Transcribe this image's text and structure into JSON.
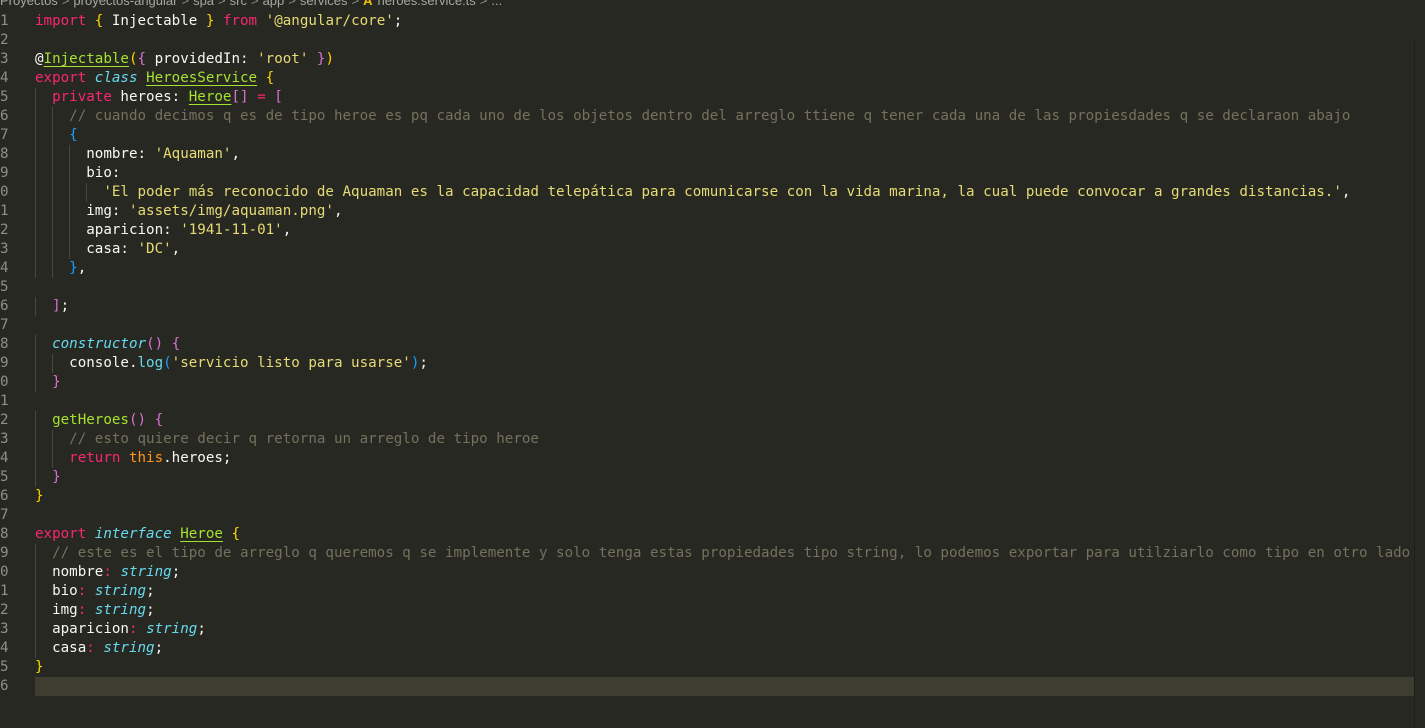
{
  "breadcrumb": [
    "Proyectos",
    "proyectos-angular",
    "spa",
    "src",
    "app",
    "services",
    "heroes.service.ts",
    "..."
  ],
  "colors": {
    "background": "#272822",
    "keyword": "#f92672",
    "string": "#e6db74",
    "comment": "#75715e",
    "class_name": "#a6e22e",
    "type": "#66d9ef",
    "current_line": "#3e3d32"
  },
  "file_icon": "angular-icon",
  "current_line": 36,
  "lines": [
    {
      "n": "1",
      "t": [
        [
          "k",
          "import"
        ],
        [
          "t",
          " "
        ],
        [
          "y",
          "{"
        ],
        [
          "t",
          " Injectable "
        ],
        [
          "y",
          "}"
        ],
        [
          "t",
          " "
        ],
        [
          "k",
          "from"
        ],
        [
          "t",
          " "
        ],
        [
          "s",
          "'@angular/core'"
        ],
        [
          "t",
          ";"
        ]
      ]
    },
    {
      "n": "2",
      "t": []
    },
    {
      "n": "3",
      "t": [
        [
          "t",
          "@"
        ],
        [
          "g",
          "Injectable"
        ],
        [
          "y",
          "("
        ],
        [
          "p",
          "{"
        ],
        [
          "t",
          " providedIn: "
        ],
        [
          "s",
          "'root'"
        ],
        [
          "t",
          " "
        ],
        [
          "p",
          "}"
        ],
        [
          "y",
          ")"
        ]
      ]
    },
    {
      "n": "4",
      "t": [
        [
          "k",
          "export"
        ],
        [
          "t",
          " "
        ],
        [
          "i",
          "class"
        ],
        [
          "t",
          " "
        ],
        [
          "g",
          "HeroesService"
        ],
        [
          "t",
          " "
        ],
        [
          "y",
          "{"
        ]
      ]
    },
    {
      "n": "5",
      "t": [
        [
          "t",
          "  "
        ],
        [
          "k",
          "private"
        ],
        [
          "t",
          " heroes: "
        ],
        [
          "g",
          "Heroe"
        ],
        [
          "p",
          "[]"
        ],
        [
          "t",
          " "
        ],
        [
          "r",
          "="
        ],
        [
          "t",
          " "
        ],
        [
          "p",
          "["
        ]
      ]
    },
    {
      "n": "6",
      "t": [
        [
          "t",
          "    "
        ],
        [
          "c",
          "// cuando decimos q es de tipo heroe es pq cada uno de los objetos dentro del arreglo ttiene q tener cada una de las propiesdades q se declaraon abajo"
        ]
      ]
    },
    {
      "n": "7",
      "t": [
        [
          "t",
          "    "
        ],
        [
          "b",
          "{"
        ]
      ]
    },
    {
      "n": "8",
      "t": [
        [
          "t",
          "      nombre: "
        ],
        [
          "s",
          "'Aquaman'"
        ],
        [
          "t",
          ","
        ]
      ]
    },
    {
      "n": "9",
      "t": [
        [
          "t",
          "      bio:"
        ]
      ]
    },
    {
      "n": "0",
      "t": [
        [
          "t",
          "        "
        ],
        [
          "s",
          "'El poder más reconocido de Aquaman es la capacidad telepática para comunicarse con la vida marina, la cual puede convocar a grandes distancias.'"
        ],
        [
          "t",
          ","
        ]
      ]
    },
    {
      "n": "1",
      "t": [
        [
          "t",
          "      img: "
        ],
        [
          "s",
          "'assets/img/aquaman.png'"
        ],
        [
          "t",
          ","
        ]
      ]
    },
    {
      "n": "2",
      "t": [
        [
          "t",
          "      aparicion: "
        ],
        [
          "s",
          "'1941-11-01'"
        ],
        [
          "t",
          ","
        ]
      ]
    },
    {
      "n": "3",
      "t": [
        [
          "t",
          "      casa: "
        ],
        [
          "s",
          "'DC'"
        ],
        [
          "t",
          ","
        ]
      ]
    },
    {
      "n": "4",
      "t": [
        [
          "t",
          "    "
        ],
        [
          "b",
          "}"
        ],
        [
          "t",
          ","
        ]
      ]
    },
    {
      "n": "5",
      "t": []
    },
    {
      "n": "6",
      "t": [
        [
          "t",
          "  "
        ],
        [
          "p",
          "]"
        ],
        [
          "t",
          ";"
        ]
      ]
    },
    {
      "n": "7",
      "t": []
    },
    {
      "n": "8",
      "t": [
        [
          "t",
          "  "
        ],
        [
          "i",
          "constructor"
        ],
        [
          "p",
          "()"
        ],
        [
          "t",
          " "
        ],
        [
          "p",
          "{"
        ]
      ]
    },
    {
      "n": "9",
      "t": [
        [
          "t",
          "    console."
        ],
        [
          "f",
          "log"
        ],
        [
          "b",
          "("
        ],
        [
          "s",
          "'servicio listo para usarse'"
        ],
        [
          "b",
          ")"
        ],
        [
          "t",
          ";"
        ]
      ]
    },
    {
      "n": "0",
      "t": [
        [
          "t",
          "  "
        ],
        [
          "p",
          "}"
        ]
      ]
    },
    {
      "n": "1",
      "t": []
    },
    {
      "n": "2",
      "t": [
        [
          "t",
          "  "
        ],
        [
          "gi",
          "getHeroes"
        ],
        [
          "p",
          "()"
        ],
        [
          "t",
          " "
        ],
        [
          "p",
          "{"
        ]
      ]
    },
    {
      "n": "3",
      "t": [
        [
          "t",
          "    "
        ],
        [
          "c",
          "// esto quiere decir q retorna un arreglo de tipo heroe"
        ]
      ]
    },
    {
      "n": "4",
      "t": [
        [
          "t",
          "    "
        ],
        [
          "k",
          "return"
        ],
        [
          "t",
          " "
        ],
        [
          "o",
          "this"
        ],
        [
          "t",
          ".heroes;"
        ]
      ]
    },
    {
      "n": "5",
      "t": [
        [
          "t",
          "  "
        ],
        [
          "p",
          "}"
        ]
      ]
    },
    {
      "n": "6",
      "t": [
        [
          "y",
          "}"
        ]
      ]
    },
    {
      "n": "7",
      "t": []
    },
    {
      "n": "8",
      "t": [
        [
          "k",
          "export"
        ],
        [
          "t",
          " "
        ],
        [
          "i",
          "interface"
        ],
        [
          "t",
          " "
        ],
        [
          "g",
          "Heroe"
        ],
        [
          "t",
          " "
        ],
        [
          "y",
          "{"
        ]
      ]
    },
    {
      "n": "9",
      "t": [
        [
          "t",
          "  "
        ],
        [
          "c",
          "// este es el tipo de arreglo q queremos q se implemente y solo tenga estas propiedades tipo string, lo podemos exportar para utilziarlo como tipo en otro lado"
        ]
      ]
    },
    {
      "n": "0",
      "t": [
        [
          "t",
          "  nombre"
        ],
        [
          "r",
          ":"
        ],
        [
          "t",
          " "
        ],
        [
          "i",
          "string"
        ],
        [
          "t",
          ";"
        ]
      ]
    },
    {
      "n": "1",
      "t": [
        [
          "t",
          "  bio"
        ],
        [
          "r",
          ":"
        ],
        [
          "t",
          " "
        ],
        [
          "i",
          "string"
        ],
        [
          "t",
          ";"
        ]
      ]
    },
    {
      "n": "2",
      "t": [
        [
          "t",
          "  img"
        ],
        [
          "r",
          ":"
        ],
        [
          "t",
          " "
        ],
        [
          "i",
          "string"
        ],
        [
          "t",
          ";"
        ]
      ]
    },
    {
      "n": "3",
      "t": [
        [
          "t",
          "  aparicion"
        ],
        [
          "r",
          ":"
        ],
        [
          "t",
          " "
        ],
        [
          "i",
          "string"
        ],
        [
          "t",
          ";"
        ]
      ]
    },
    {
      "n": "4",
      "t": [
        [
          "t",
          "  casa"
        ],
        [
          "r",
          ":"
        ],
        [
          "t",
          " "
        ],
        [
          "i",
          "string"
        ],
        [
          "t",
          ";"
        ]
      ]
    },
    {
      "n": "5",
      "t": [
        [
          "y",
          "}"
        ]
      ]
    },
    {
      "n": "6",
      "t": []
    }
  ]
}
